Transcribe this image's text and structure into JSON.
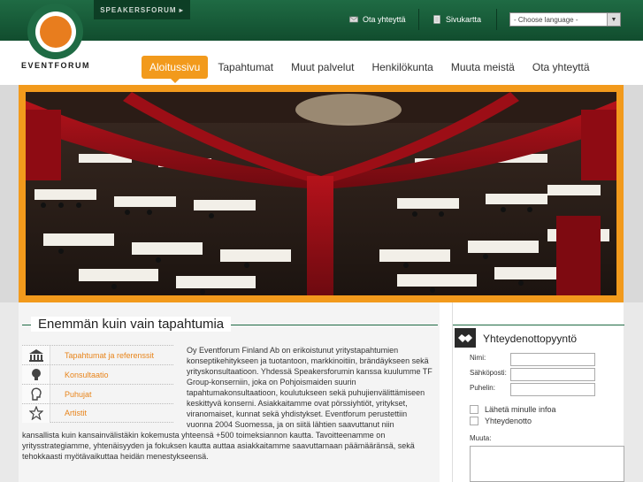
{
  "header": {
    "speakers_label": "SPEAKERSFORUM ▸",
    "util_links": [
      {
        "label": "Ota yhteyttä",
        "icon": "mail-icon"
      },
      {
        "label": "Sivukartta",
        "icon": "sitemap-icon"
      }
    ],
    "language_select": "- Choose language -",
    "logo_text": "EVENTFORUM"
  },
  "nav": {
    "items": [
      "Aloitussivu",
      "Tapahtumat",
      "Muut palvelut",
      "Henkilökunta",
      "Muuta meistä",
      "Ota yhteyttä"
    ],
    "active_index": 0
  },
  "main": {
    "title": "Enemmän kuin vain tapahtumia",
    "submenu": [
      {
        "label": "Tapahtumat ja referenssit",
        "icon": "institution-icon"
      },
      {
        "label": "Konsultaatio",
        "icon": "lightbulb-icon"
      },
      {
        "label": "Puhujat",
        "icon": "speaker-head-icon"
      },
      {
        "label": "Artistit",
        "icon": "star-icon"
      }
    ],
    "body_text": "Oy Eventforum Finland Ab on erikoistunut yritystapahtumien konseptikehitykseen ja tuotantoon, markkinoitiin, brändäykseen sekä yrityskonsultaatioon. Yhdessä Speakersforumin kanssa kuulumme TF Group-konserniin, joka on Pohjoismaiden suurin tapahtumakonsultaatioon, koulutukseen sekä puhujienvälittämiseen keskittyvä konserni. Asiakkaitamme ovat pörssiyhtiöt, yritykset, viranomaiset, kunnat sekä yhdistykset. Eventforum perustettiin vuonna 2004 Suomessa, ja on siitä lähtien saavuttanut niin kansallista kuin kansainvälistäkin kokemusta yhteensä +500 toimeksiannon kautta. Tavoitteenamme on yritysstrategiamme, yhtenäisyyden ja fokuksen kautta auttaa asiakkaitamme saavuttamaan päämääränsä, sekä tehokkaasti myötävaikuttaa heidän menestykseensä."
  },
  "sidebar": {
    "title": "Yhteydenottopyyntö",
    "fields": [
      {
        "label": "Nimi:",
        "value": ""
      },
      {
        "label": "Sähköposti:",
        "value": ""
      },
      {
        "label": "Puhelin:",
        "value": ""
      }
    ],
    "checkboxes": [
      "Lähetä minulle infoa",
      "Yhteydenotto"
    ],
    "message_label": "Muuta:"
  },
  "colors": {
    "brand_green": "#1f6b44",
    "accent_orange": "#f29a1c"
  }
}
